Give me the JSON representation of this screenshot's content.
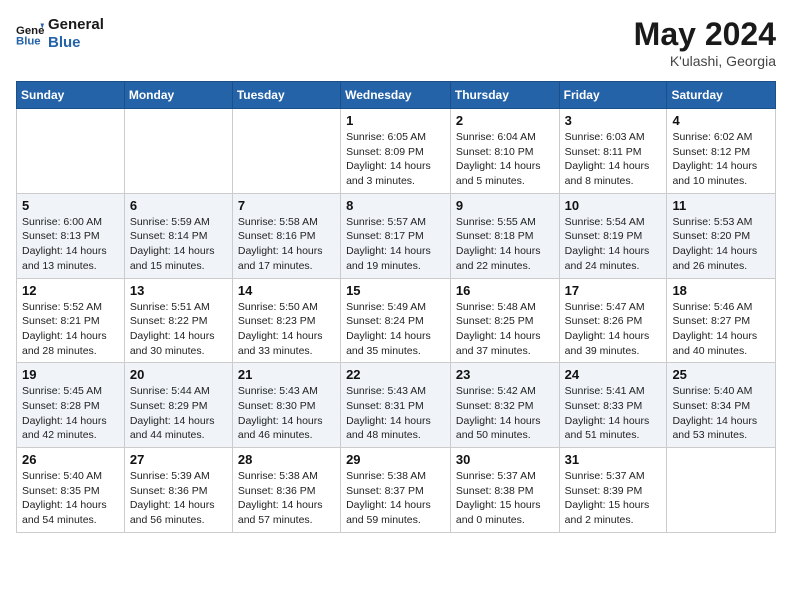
{
  "header": {
    "logo_line1": "General",
    "logo_line2": "Blue",
    "month_title": "May 2024",
    "location": "K'ulashi, Georgia"
  },
  "weekdays": [
    "Sunday",
    "Monday",
    "Tuesday",
    "Wednesday",
    "Thursday",
    "Friday",
    "Saturday"
  ],
  "weeks": [
    [
      {
        "day": "",
        "sunrise": "",
        "sunset": "",
        "daylight": ""
      },
      {
        "day": "",
        "sunrise": "",
        "sunset": "",
        "daylight": ""
      },
      {
        "day": "",
        "sunrise": "",
        "sunset": "",
        "daylight": ""
      },
      {
        "day": "1",
        "sunrise": "Sunrise: 6:05 AM",
        "sunset": "Sunset: 8:09 PM",
        "daylight": "Daylight: 14 hours and 3 minutes."
      },
      {
        "day": "2",
        "sunrise": "Sunrise: 6:04 AM",
        "sunset": "Sunset: 8:10 PM",
        "daylight": "Daylight: 14 hours and 5 minutes."
      },
      {
        "day": "3",
        "sunrise": "Sunrise: 6:03 AM",
        "sunset": "Sunset: 8:11 PM",
        "daylight": "Daylight: 14 hours and 8 minutes."
      },
      {
        "day": "4",
        "sunrise": "Sunrise: 6:02 AM",
        "sunset": "Sunset: 8:12 PM",
        "daylight": "Daylight: 14 hours and 10 minutes."
      }
    ],
    [
      {
        "day": "5",
        "sunrise": "Sunrise: 6:00 AM",
        "sunset": "Sunset: 8:13 PM",
        "daylight": "Daylight: 14 hours and 13 minutes."
      },
      {
        "day": "6",
        "sunrise": "Sunrise: 5:59 AM",
        "sunset": "Sunset: 8:14 PM",
        "daylight": "Daylight: 14 hours and 15 minutes."
      },
      {
        "day": "7",
        "sunrise": "Sunrise: 5:58 AM",
        "sunset": "Sunset: 8:16 PM",
        "daylight": "Daylight: 14 hours and 17 minutes."
      },
      {
        "day": "8",
        "sunrise": "Sunrise: 5:57 AM",
        "sunset": "Sunset: 8:17 PM",
        "daylight": "Daylight: 14 hours and 19 minutes."
      },
      {
        "day": "9",
        "sunrise": "Sunrise: 5:55 AM",
        "sunset": "Sunset: 8:18 PM",
        "daylight": "Daylight: 14 hours and 22 minutes."
      },
      {
        "day": "10",
        "sunrise": "Sunrise: 5:54 AM",
        "sunset": "Sunset: 8:19 PM",
        "daylight": "Daylight: 14 hours and 24 minutes."
      },
      {
        "day": "11",
        "sunrise": "Sunrise: 5:53 AM",
        "sunset": "Sunset: 8:20 PM",
        "daylight": "Daylight: 14 hours and 26 minutes."
      }
    ],
    [
      {
        "day": "12",
        "sunrise": "Sunrise: 5:52 AM",
        "sunset": "Sunset: 8:21 PM",
        "daylight": "Daylight: 14 hours and 28 minutes."
      },
      {
        "day": "13",
        "sunrise": "Sunrise: 5:51 AM",
        "sunset": "Sunset: 8:22 PM",
        "daylight": "Daylight: 14 hours and 30 minutes."
      },
      {
        "day": "14",
        "sunrise": "Sunrise: 5:50 AM",
        "sunset": "Sunset: 8:23 PM",
        "daylight": "Daylight: 14 hours and 33 minutes."
      },
      {
        "day": "15",
        "sunrise": "Sunrise: 5:49 AM",
        "sunset": "Sunset: 8:24 PM",
        "daylight": "Daylight: 14 hours and 35 minutes."
      },
      {
        "day": "16",
        "sunrise": "Sunrise: 5:48 AM",
        "sunset": "Sunset: 8:25 PM",
        "daylight": "Daylight: 14 hours and 37 minutes."
      },
      {
        "day": "17",
        "sunrise": "Sunrise: 5:47 AM",
        "sunset": "Sunset: 8:26 PM",
        "daylight": "Daylight: 14 hours and 39 minutes."
      },
      {
        "day": "18",
        "sunrise": "Sunrise: 5:46 AM",
        "sunset": "Sunset: 8:27 PM",
        "daylight": "Daylight: 14 hours and 40 minutes."
      }
    ],
    [
      {
        "day": "19",
        "sunrise": "Sunrise: 5:45 AM",
        "sunset": "Sunset: 8:28 PM",
        "daylight": "Daylight: 14 hours and 42 minutes."
      },
      {
        "day": "20",
        "sunrise": "Sunrise: 5:44 AM",
        "sunset": "Sunset: 8:29 PM",
        "daylight": "Daylight: 14 hours and 44 minutes."
      },
      {
        "day": "21",
        "sunrise": "Sunrise: 5:43 AM",
        "sunset": "Sunset: 8:30 PM",
        "daylight": "Daylight: 14 hours and 46 minutes."
      },
      {
        "day": "22",
        "sunrise": "Sunrise: 5:43 AM",
        "sunset": "Sunset: 8:31 PM",
        "daylight": "Daylight: 14 hours and 48 minutes."
      },
      {
        "day": "23",
        "sunrise": "Sunrise: 5:42 AM",
        "sunset": "Sunset: 8:32 PM",
        "daylight": "Daylight: 14 hours and 50 minutes."
      },
      {
        "day": "24",
        "sunrise": "Sunrise: 5:41 AM",
        "sunset": "Sunset: 8:33 PM",
        "daylight": "Daylight: 14 hours and 51 minutes."
      },
      {
        "day": "25",
        "sunrise": "Sunrise: 5:40 AM",
        "sunset": "Sunset: 8:34 PM",
        "daylight": "Daylight: 14 hours and 53 minutes."
      }
    ],
    [
      {
        "day": "26",
        "sunrise": "Sunrise: 5:40 AM",
        "sunset": "Sunset: 8:35 PM",
        "daylight": "Daylight: 14 hours and 54 minutes."
      },
      {
        "day": "27",
        "sunrise": "Sunrise: 5:39 AM",
        "sunset": "Sunset: 8:36 PM",
        "daylight": "Daylight: 14 hours and 56 minutes."
      },
      {
        "day": "28",
        "sunrise": "Sunrise: 5:38 AM",
        "sunset": "Sunset: 8:36 PM",
        "daylight": "Daylight: 14 hours and 57 minutes."
      },
      {
        "day": "29",
        "sunrise": "Sunrise: 5:38 AM",
        "sunset": "Sunset: 8:37 PM",
        "daylight": "Daylight: 14 hours and 59 minutes."
      },
      {
        "day": "30",
        "sunrise": "Sunrise: 5:37 AM",
        "sunset": "Sunset: 8:38 PM",
        "daylight": "Daylight: 15 hours and 0 minutes."
      },
      {
        "day": "31",
        "sunrise": "Sunrise: 5:37 AM",
        "sunset": "Sunset: 8:39 PM",
        "daylight": "Daylight: 15 hours and 2 minutes."
      },
      {
        "day": "",
        "sunrise": "",
        "sunset": "",
        "daylight": ""
      }
    ]
  ]
}
